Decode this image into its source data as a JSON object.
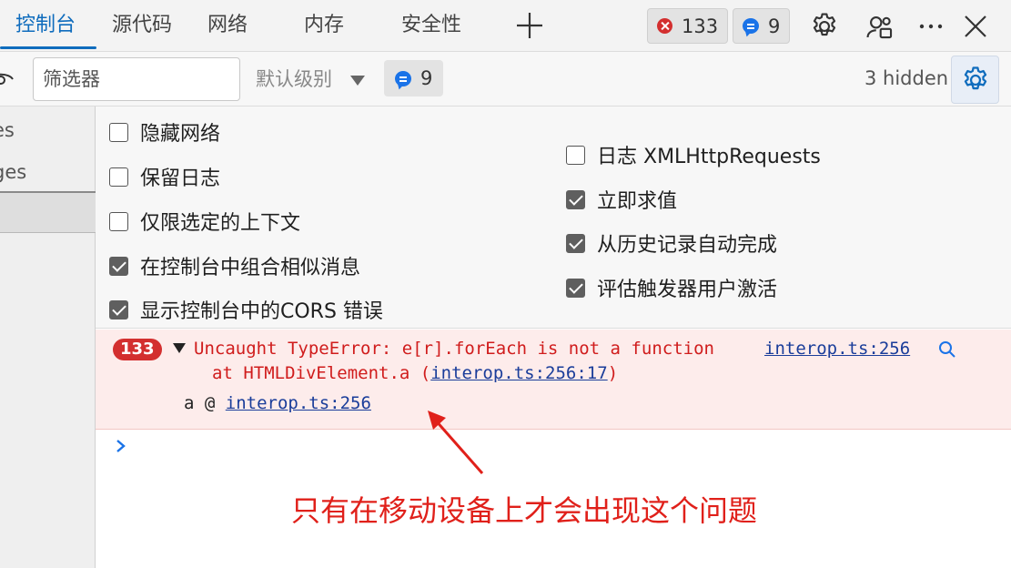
{
  "tabs": [
    {
      "label": "控制台",
      "active": true
    },
    {
      "label": "源代码"
    },
    {
      "label": "网络"
    },
    {
      "label": "内存"
    },
    {
      "label": "安全性"
    }
  ],
  "header": {
    "error_count": "133",
    "message_count": "9",
    "icons": [
      "add-tab-icon",
      "gear-icon",
      "experiments-icon",
      "more-icon",
      "close-icon"
    ]
  },
  "toolbar": {
    "filter_placeholder": "筛选器",
    "level_label": "默认级别",
    "message_count": "9",
    "hidden_label": "3 hidden"
  },
  "sidebar": {
    "items": [
      "es",
      "ges"
    ]
  },
  "settings": {
    "left": [
      {
        "label": "隐藏网络",
        "checked": false
      },
      {
        "label": "保留日志",
        "checked": false
      },
      {
        "label": "仅限选定的上下文",
        "checked": false
      },
      {
        "label": "在控制台中组合相似消息",
        "checked": true
      },
      {
        "label": "显示控制台中的CORS 错误",
        "checked": true
      }
    ],
    "right": [
      {
        "label": "日志 XMLHttpRequests",
        "checked": false
      },
      {
        "label": "立即求值",
        "checked": true
      },
      {
        "label": "从历史记录自动完成",
        "checked": true
      },
      {
        "label": "评估触发器用户激活",
        "checked": true
      }
    ]
  },
  "console": {
    "error_badge": "133",
    "error_message": "Uncaught TypeError: e[r].forEach is not a function",
    "error_source": "interop.ts:256",
    "stack_prefix": "at HTMLDivElement.a (",
    "stack_link": "interop.ts:256:17",
    "stack_suffix": ")",
    "call_prefix": "a @ ",
    "call_link": "interop.ts:256"
  },
  "annotation": {
    "text": "只有在移动设备上才会出现这个问题",
    "color": "#e0201a"
  },
  "colors": {
    "accent": "#0f6cbd",
    "error": "#d32f2f",
    "error_bg": "#fdeceb",
    "link": "#1a3d9a"
  }
}
